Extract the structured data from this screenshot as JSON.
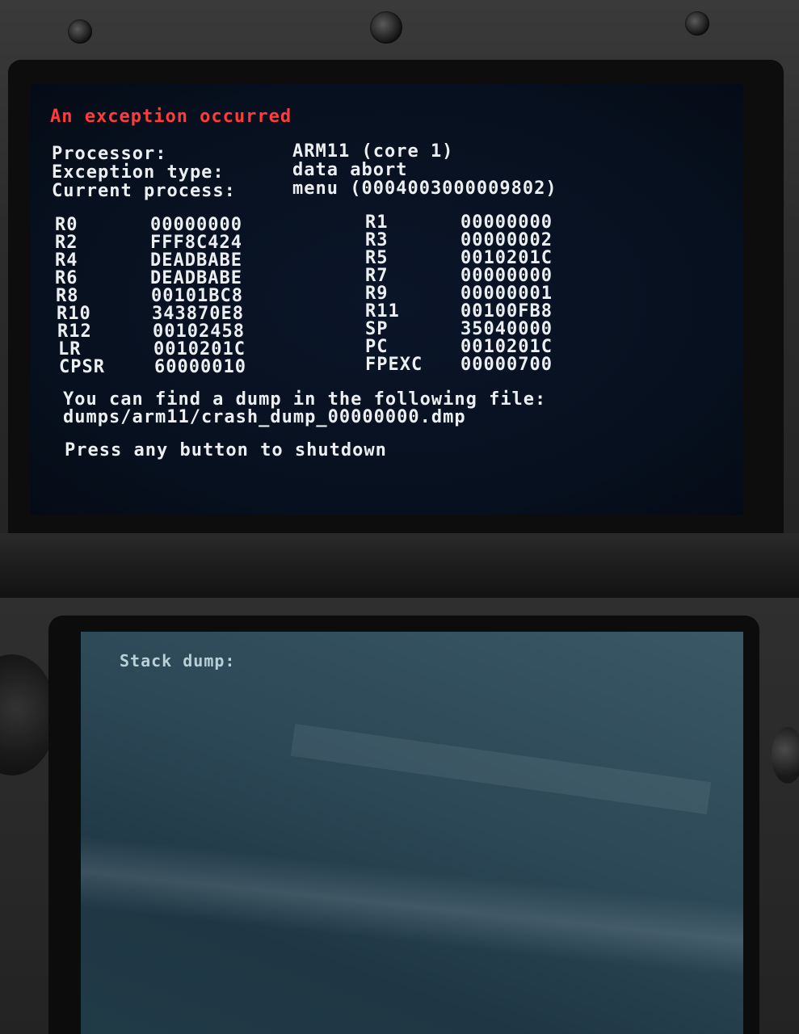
{
  "top_screen": {
    "title": "An exception occurred",
    "info": {
      "processor_label": "Processor:",
      "processor_value": "ARM11 (core 1)",
      "exception_label": "Exception type:",
      "exception_value": "data abort",
      "process_label": "Current process:",
      "process_value": "menu (0004003000009802)"
    },
    "registers_left": [
      {
        "name": "R0",
        "value": "00000000"
      },
      {
        "name": "R2",
        "value": "FFF8C424"
      },
      {
        "name": "R4",
        "value": "DEADBABE"
      },
      {
        "name": "R6",
        "value": "DEADBABE"
      },
      {
        "name": "R8",
        "value": "00101BC8"
      },
      {
        "name": "R10",
        "value": "343870E8"
      },
      {
        "name": "R12",
        "value": "00102458"
      },
      {
        "name": "LR",
        "value": "0010201C"
      },
      {
        "name": "CPSR",
        "value": "60000010"
      }
    ],
    "registers_right": [
      {
        "name": "R1",
        "value": "00000000"
      },
      {
        "name": "R3",
        "value": "00000002"
      },
      {
        "name": "R5",
        "value": "0010201C"
      },
      {
        "name": "R7",
        "value": "00000000"
      },
      {
        "name": "R9",
        "value": "00000001"
      },
      {
        "name": "R11",
        "value": "00100FB8"
      },
      {
        "name": "SP",
        "value": "35040000"
      },
      {
        "name": "PC",
        "value": "0010201C"
      },
      {
        "name": "FPEXC",
        "value": "00000700"
      }
    ],
    "dump_message": "You can find a dump in the following file:",
    "dump_path": "dumps/arm11/crash_dump_00000000.dmp",
    "prompt": "Press any button to shutdown"
  },
  "bottom_screen": {
    "label": "Stack dump:"
  },
  "colors": {
    "title": "#ff3b3b",
    "text": "#eceff2",
    "screen_bg": "#07101e",
    "bottom_screen_bg": "#2c4756"
  }
}
